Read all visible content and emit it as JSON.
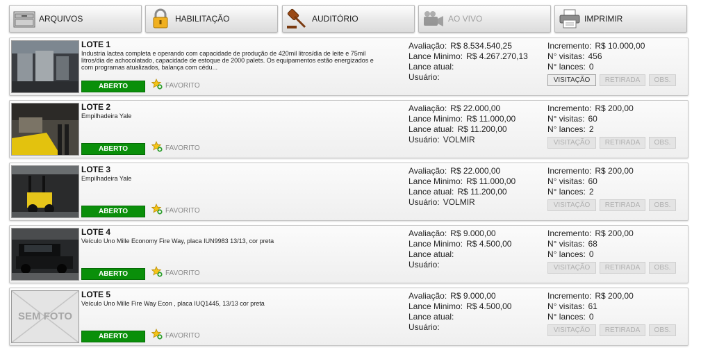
{
  "toolbar": {
    "arquivos": {
      "label": "ARQUIVOS",
      "icon": "folder-icon"
    },
    "habilitacao": {
      "label": "HABILITAÇÃO",
      "icon": "padlock-icon"
    },
    "auditorio": {
      "label": "AUDITÓRIO",
      "icon": "gavel-icon"
    },
    "aovivo": {
      "label": "AO VIVO",
      "icon": "video-camera-icon"
    },
    "imprimir": {
      "label": "IMPRIMIR",
      "icon": "printer-icon"
    }
  },
  "labels": {
    "avaliacao": "Avaliação:",
    "lance_minimo": "Lance Minimo:",
    "lance_atual": "Lance atual:",
    "usuario": "Usuário:",
    "incremento": "Incremento:",
    "visitas": "N° visitas:",
    "lances": "N° lances:",
    "open_button": "ABERTO",
    "favorite": "FAVORITO",
    "visitacao": "VISITAÇÃO",
    "retirada": "RETIRADA",
    "obs": "OBS.",
    "no_photo": "SEM FOTO"
  },
  "lots": [
    {
      "title": "LOTE 1",
      "description": "Industria lactea completa e operando com capacidade de produção de 420mil litros/dia de leite e 75mil litros/dia de achocolatado, capacidade de estoque de 2000 palets. Os equipamentos estão energizados e com programas atualizados, balança com cédu...",
      "avaliacao": "R$ 8.534.540,25",
      "lance_minimo": "R$ 4.267.270,13",
      "lance_atual": "",
      "usuario": "",
      "incremento": "R$ 10.000,00",
      "visitas": "456",
      "lances": "0",
      "visitacao_enabled": true
    },
    {
      "title": "LOTE 2",
      "description": "Empilhadeira Yale",
      "avaliacao": "R$ 22.000,00",
      "lance_minimo": "R$ 11.000,00",
      "lance_atual": "R$ 11.200,00",
      "usuario": "VOLMIR",
      "incremento": "R$ 200,00",
      "visitas": "60",
      "lances": "2",
      "visitacao_enabled": false
    },
    {
      "title": "LOTE 3",
      "description": "Empilhadeira Yale",
      "avaliacao": "R$ 22.000,00",
      "lance_minimo": "R$ 11.000,00",
      "lance_atual": "R$ 11.200,00",
      "usuario": "VOLMIR",
      "incremento": "R$ 200,00",
      "visitas": "60",
      "lances": "2",
      "visitacao_enabled": false
    },
    {
      "title": "LOTE 4",
      "description": "Veículo Uno Mille Economy Fire Way, placa IUN9983 13/13, cor preta",
      "avaliacao": "R$ 9.000,00",
      "lance_minimo": "R$ 4.500,00",
      "lance_atual": "",
      "usuario": "",
      "incremento": "R$ 200,00",
      "visitas": "68",
      "lances": "0",
      "visitacao_enabled": false
    },
    {
      "title": "LOTE 5",
      "description": "Veículo Uno Mille Fire Way Econ , placa IUQ1445, 13/13 cor preta",
      "avaliacao": "R$ 9.000,00",
      "lance_minimo": "R$ 4.500,00",
      "lance_atual": "",
      "usuario": "",
      "incremento": "R$ 200,00",
      "visitas": "61",
      "lances": "0",
      "visitacao_enabled": false
    }
  ],
  "colors": {
    "open_green": "#0a8f0a",
    "star": "#f5c518"
  }
}
